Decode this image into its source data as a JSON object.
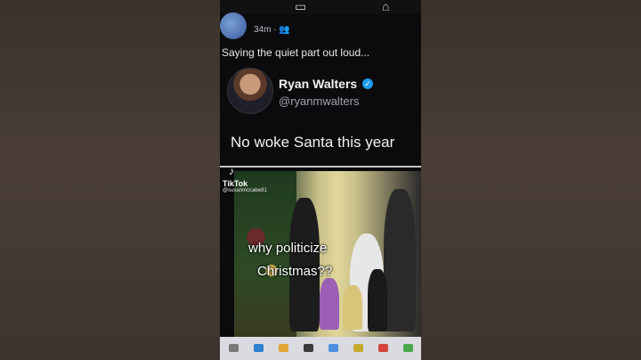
{
  "post": {
    "time": "34m ·",
    "quote_text": "Saying the quiet part out loud...",
    "author_name": "Ryan Walters",
    "author_handle": "@ryanmwalters",
    "tweet_text": "No woke Santa this year"
  },
  "overlay": {
    "tiktok_label": "TikTok",
    "tiktok_user": "@susanmccabe81",
    "caption_line1": "why politicize",
    "caption_line2": "Christmas??"
  },
  "icons": {
    "top_center": "monitor-icon",
    "top_right": "home-icon",
    "meta": "people-icon",
    "verified": "verified-badge-icon",
    "tiktok": "tiktok-icon"
  },
  "colors": {
    "verified": "#1d9bf0",
    "screen_bg": "#0b0b0d",
    "taskbar": "#d9dbe0"
  }
}
